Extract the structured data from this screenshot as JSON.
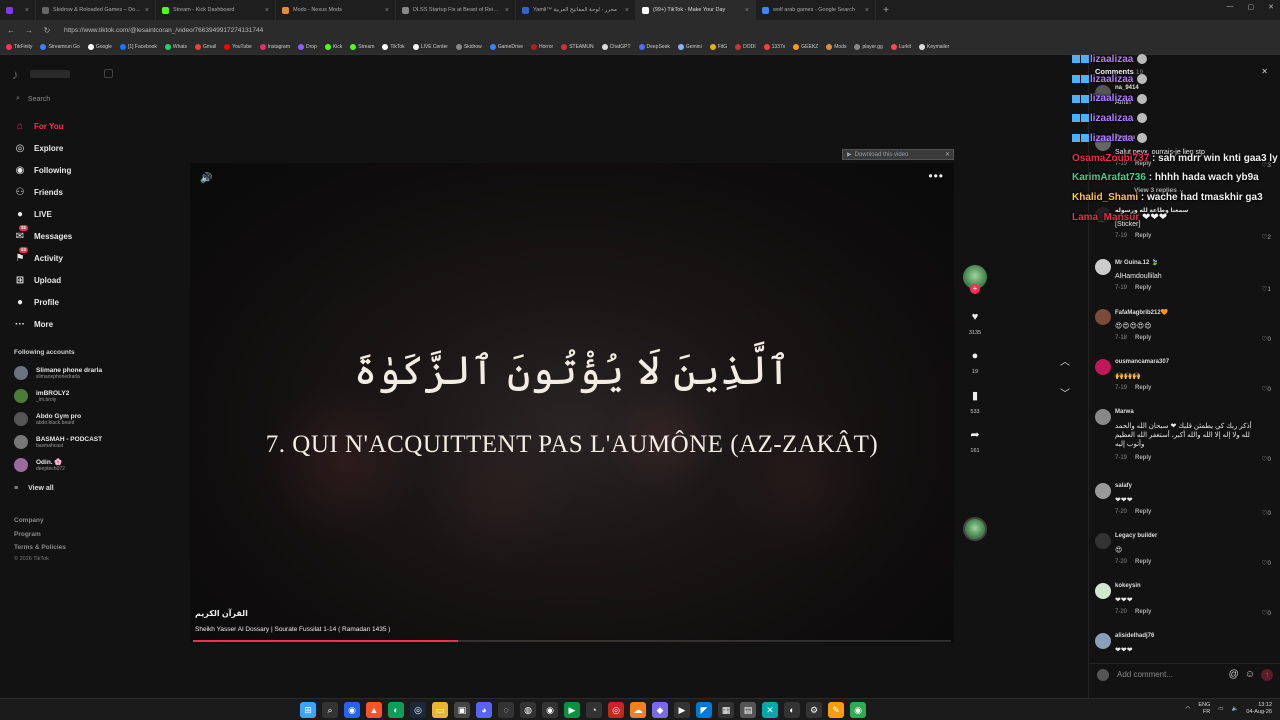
{
  "browser": {
    "tabs": [
      {
        "label": "",
        "color": "#7c3aed",
        "active": false
      },
      {
        "label": "Skidrow & Reloaded Games – Do...",
        "color": "#666666",
        "active": false
      },
      {
        "label": "Stream - Kick Dashboard",
        "color": "#53fc18",
        "active": false
      },
      {
        "label": "Mods - Nexus Mods",
        "color": "#d98f40",
        "active": false
      },
      {
        "label": "DLSS Startup Fix at Beast of Reinc...",
        "color": "#888888",
        "active": false
      },
      {
        "label": "Yamli™ محرر - لوحة المفاتيح العربية",
        "color": "#3366cc",
        "active": false
      },
      {
        "label": "(99+) TikTok - Make Your Day",
        "color": "#ffffff",
        "active": true
      },
      {
        "label": "wolf arab games - Google Search",
        "color": "#4285f4",
        "active": false
      }
    ],
    "new_tab": "+",
    "window_controls": [
      "—",
      "▢",
      "✕"
    ],
    "nav": {
      "back": "←",
      "forward": "→",
      "reload": "↻"
    },
    "url": "https://www.tiktok.com/@lesaintcoran_/video/7663949917274131744",
    "bookmarks": [
      {
        "label": "TikFinity",
        "color": "#ff3355"
      },
      {
        "label": "Streamrun Go",
        "color": "#3b82f6"
      },
      {
        "label": "Google",
        "color": "#ffffff"
      },
      {
        "label": "[1] Facebook",
        "color": "#1877f2"
      },
      {
        "label": "Whats",
        "color": "#25d366"
      },
      {
        "label": "Gmail",
        "color": "#ea4335"
      },
      {
        "label": "YouTube",
        "color": "#ff0000"
      },
      {
        "label": "Instagram",
        "color": "#e1306c"
      },
      {
        "label": "Drop",
        "color": "#8b5cf6"
      },
      {
        "label": "Kick",
        "color": "#53fc18"
      },
      {
        "label": "Stream",
        "color": "#53fc18"
      },
      {
        "label": "TikTok",
        "color": "#ffffff"
      },
      {
        "label": "LIVE Center",
        "color": "#ffffff"
      },
      {
        "label": "Skidrow",
        "color": "#888888"
      },
      {
        "label": "GameDrive",
        "color": "#3b82f6"
      },
      {
        "label": "Horror",
        "color": "#aa2222"
      },
      {
        "label": "STEAMUN",
        "color": "#cc3333"
      },
      {
        "label": "ChatGPT",
        "color": "#dddddd"
      },
      {
        "label": "DeepSeek",
        "color": "#4d6bfe"
      },
      {
        "label": "Gemini",
        "color": "#8ab4f8"
      },
      {
        "label": "FitG",
        "color": "#e7b416"
      },
      {
        "label": "DODI",
        "color": "#cc3333"
      },
      {
        "label": "1337x",
        "color": "#f44336"
      },
      {
        "label": "GEEKZ",
        "color": "#f59e0b"
      },
      {
        "label": "Mods",
        "color": "#d98f40"
      },
      {
        "label": "player.gg",
        "color": "#888888"
      },
      {
        "label": "Lurkit",
        "color": "#ff4455"
      },
      {
        "label": "Keymailer",
        "color": "#dddddd"
      }
    ]
  },
  "sidebar": {
    "search_placeholder": "Search",
    "items": [
      {
        "label": "For You",
        "icon": "home-icon",
        "glyph": "⌂",
        "badge": "",
        "active": true
      },
      {
        "label": "Explore",
        "icon": "compass-icon",
        "glyph": "◎",
        "badge": "",
        "active": false
      },
      {
        "label": "Following",
        "icon": "following-icon",
        "glyph": "◉",
        "badge": "",
        "active": false
      },
      {
        "label": "Friends",
        "icon": "friends-icon",
        "glyph": "⚇",
        "badge": "",
        "active": false
      },
      {
        "label": "LIVE",
        "icon": "live-icon",
        "glyph": "●",
        "badge": "",
        "active": false
      },
      {
        "label": "Messages",
        "icon": "messages-icon",
        "glyph": "✉",
        "badge": "92",
        "active": false
      },
      {
        "label": "Activity",
        "icon": "activity-icon",
        "glyph": "⚑",
        "badge": "63",
        "active": false
      },
      {
        "label": "Upload",
        "icon": "upload-icon",
        "glyph": "⊞",
        "badge": "",
        "active": false
      },
      {
        "label": "Profile",
        "icon": "profile-icon",
        "glyph": "●",
        "badge": "",
        "active": false
      },
      {
        "label": "More",
        "icon": "more-icon",
        "glyph": "···",
        "badge": "",
        "active": false
      }
    ],
    "following_title": "Following accounts",
    "accounts": [
      {
        "name": "Slimane phone drarla",
        "handle": "slimanephonedrarla",
        "color": "#6b7280"
      },
      {
        "name": "imBROLY2",
        "handle": "_lm.broly",
        "color": "#4d7c3a"
      },
      {
        "name": "Abdo Gym pro",
        "handle": "abdo.black.beard",
        "color": "#555555"
      },
      {
        "name": "BASMAH - PODCAST",
        "handle": "basmahcast",
        "color": "#777777"
      },
      {
        "name": "Odin. 🌸",
        "handle": "deeptech072",
        "color": "#9b6b9e"
      }
    ],
    "view_all": "View all",
    "footer": [
      "Company",
      "Program",
      "Terms & Policies"
    ],
    "copyright": "© 2026 TikTok"
  },
  "video": {
    "arabic_text": "ٱلَّذِينَ لَا يُؤْتُونَ ٱلزَّكَوٰةَ",
    "french_text": "7. QUI N'ACQUITTENT PAS L'AUMÔNE (AZ-ZAKÂT)",
    "caption_title": "القرآن الكريم",
    "caption_desc": "Sheikh Yasser Al Dossary | Sourate Fussilat 1-14 ( Ramadan 1435 )",
    "progress": 0.35,
    "download_label": "Download this video",
    "likes": "3135",
    "comments": "19",
    "saves": "533",
    "shares": "161"
  },
  "comments_panel": {
    "title": "Comments",
    "count": "19",
    "view_replies": "View 3 replies",
    "add_placeholder": "Add comment...",
    "items": [
      {
        "name": "na_9414",
        "text": "Amin",
        "date": "",
        "likes": "",
        "color": "#555555"
      },
      {
        "name": "Toutou",
        "text": "Salut peyx, ourrais-je lien stp",
        "date": "7-19",
        "likes": "3",
        "color": "#666666"
      },
      {
        "name": "سمعنا وطاعة لله ورسوله",
        "text": "[Sticker]",
        "date": "7-19",
        "likes": "2",
        "color": "#222222"
      },
      {
        "name": "Mr Guina.12 🍃",
        "text": "AlHamdoullilah",
        "date": "7-19",
        "likes": "1",
        "color": "#cccccc"
      },
      {
        "name": "FafaMagbrib212🧡",
        "text": "😍😍😍😍😍",
        "date": "7-18",
        "likes": "0",
        "color": "#7a4a3a"
      },
      {
        "name": "ousmancamara307",
        "text": "🙌🙌🙌",
        "date": "7-19",
        "likes": "0",
        "color": "#c0185a"
      },
      {
        "name": "Marwa",
        "text": "أذكر ربك كي يطمئن قلبك ❤ سبحان الله والحمد لله ولا إله إلا الله والله أكبر، أستغفر الله العظيم وأتوب إليه",
        "date": "7-19",
        "likes": "0",
        "color": "#888888"
      },
      {
        "name": "salafy",
        "text": "❤❤❤",
        "date": "7-20",
        "likes": "0",
        "color": "#999999"
      },
      {
        "name": "Legacy builder",
        "text": "😍",
        "date": "7-20",
        "likes": "0",
        "color": "#333333"
      },
      {
        "name": "kokeysin",
        "text": "❤❤❤",
        "date": "7-20",
        "likes": "0",
        "color": "#cfe8cf"
      },
      {
        "name": "alisidelhadj76",
        "text": "❤❤❤",
        "date": "",
        "likes": "",
        "color": "#8aa0b8"
      }
    ],
    "reply_label": "Reply"
  },
  "stream_chat": [
    {
      "user": "lizaalizaa",
      "msg": "",
      "color": "#b37bff"
    },
    {
      "user": "lizaalizaa",
      "msg": "",
      "color": "#b37bff"
    },
    {
      "user": "lizaalizaa",
      "msg": "",
      "color": "#b37bff"
    },
    {
      "user": "lizaalizaa",
      "msg": "",
      "color": "#b37bff"
    },
    {
      "user": "lizaalizaa",
      "msg": "",
      "color": "#b37bff"
    },
    {
      "user": "OsamaZoubi737",
      "msg": " : sah mdrr win knti gaa3 ly",
      "color": "#e0344a"
    },
    {
      "user": "KarimArafat736",
      "msg": " : hhhh hada wach yb9a",
      "color": "#3fd18b"
    },
    {
      "user": "Khalid_Shami",
      "msg": " : wache had tmaskhir ga3",
      "color": "#ffc24a"
    },
    {
      "user": "Lama_Mansur",
      "msg": " ❤❤❤",
      "color": "#e0344a"
    }
  ],
  "taskbar": {
    "icons": [
      {
        "name": "windows-start-icon",
        "glyph": "⊞",
        "color": "#3ba5ff"
      },
      {
        "name": "search-icon",
        "glyph": "⌕",
        "color": "#333333"
      },
      {
        "name": "copilot-icon",
        "glyph": "◉",
        "color": "#2563eb"
      },
      {
        "name": "brave-icon",
        "glyph": "▲",
        "color": "#fb542b"
      },
      {
        "name": "edge-icon",
        "glyph": "◐",
        "color": "#0f9d58"
      },
      {
        "name": "steam-icon",
        "glyph": "◎",
        "color": "#1b2838"
      },
      {
        "name": "folder-icon",
        "glyph": "▭",
        "color": "#e8b43a"
      },
      {
        "name": "store-icon",
        "glyph": "▣",
        "color": "#444444"
      },
      {
        "name": "discord-icon",
        "glyph": "◕",
        "color": "#5865f2"
      },
      {
        "name": "app-icon",
        "glyph": "◌",
        "color": "#333333"
      },
      {
        "name": "camera-icon",
        "glyph": "◍",
        "color": "#333333"
      },
      {
        "name": "obs-icon",
        "glyph": "◉",
        "color": "#333333"
      },
      {
        "name": "play-icon",
        "glyph": "▶",
        "color": "#0c8f3e"
      },
      {
        "name": "clock-icon",
        "glyph": "◔",
        "color": "#333333"
      },
      {
        "name": "record-icon",
        "glyph": "◎",
        "color": "#cc2222"
      },
      {
        "name": "cloud-icon",
        "glyph": "☁",
        "color": "#f38020"
      },
      {
        "name": "teams-icon",
        "glyph": "◆",
        "color": "#7b68ee"
      },
      {
        "name": "video-icon",
        "glyph": "▶",
        "color": "#333333"
      },
      {
        "name": "vscode-icon",
        "glyph": "◤",
        "color": "#0078d4"
      },
      {
        "name": "terminal-icon",
        "glyph": "▦",
        "color": "#333333"
      },
      {
        "name": "calc-icon",
        "glyph": "▤",
        "color": "#555555"
      },
      {
        "name": "capcut-icon",
        "glyph": "✕",
        "color": "#0aa"
      },
      {
        "name": "github-icon",
        "glyph": "◐",
        "color": "#333333"
      },
      {
        "name": "gear-icon",
        "glyph": "⚙",
        "color": "#333333"
      },
      {
        "name": "hammer-icon",
        "glyph": "✎",
        "color": "#f59e0b"
      },
      {
        "name": "chrome-icon",
        "glyph": "◉",
        "color": "#34a853"
      }
    ],
    "lang": "ENG",
    "region": "FR",
    "time": "13:12",
    "date": "04-Aug-26"
  }
}
